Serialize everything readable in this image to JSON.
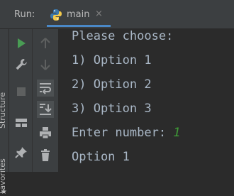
{
  "run_panel": {
    "title": "Run:",
    "tab": {
      "label": "main",
      "icon": "python-icon",
      "close_glyph": "×"
    },
    "side_labels": {
      "structure": "Structure",
      "favorites": "Favorites"
    }
  },
  "toolbar": {
    "left": [
      "run-icon",
      "wrench-icon",
      "stop-icon",
      "layout-icon",
      "pin-icon"
    ],
    "right": [
      "arrow-up-icon",
      "arrow-down-icon",
      "soft-wrap-icon",
      "scroll-to-end-icon",
      "print-icon",
      "trash-icon"
    ]
  },
  "console": {
    "lines": [
      "Please choose:",
      "1) Option 1",
      "2) Option 2",
      "3) Option 3"
    ],
    "prompt": "Enter number: ",
    "input_value": "1",
    "result": "Option 1"
  },
  "colors": {
    "background": "#2b2b2b",
    "panel": "#3c3f41",
    "console_text": "#a9b7c6",
    "user_input": "#3f9b37",
    "run_green": "#499c54"
  }
}
